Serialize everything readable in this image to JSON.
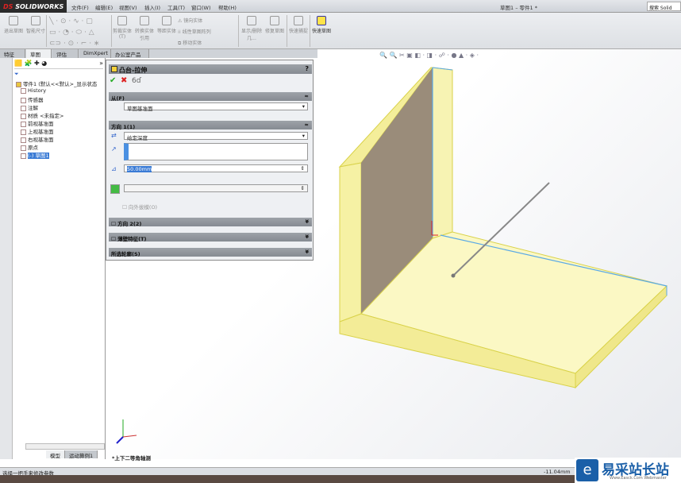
{
  "app": {
    "brand": "SOLIDWORKS",
    "title": "草图1 – 零件1 *",
    "search_placeholder": "搜索 Solid"
  },
  "menu": [
    "文件(F)",
    "编辑(E)",
    "视图(V)",
    "插入(I)",
    "工具(T)",
    "窗口(W)",
    "帮助(H)"
  ],
  "toolbar": {
    "exit_sketch": "退出草图",
    "smart_dim": "智能尺寸",
    "trim": "剪裁实体(T)",
    "convert": "转换实体引用",
    "offset": "等距实体",
    "mirror": "镜向实体",
    "linear_pattern": "线性草图阵列",
    "move": "移动实体",
    "display_delete": "显示/删除几...",
    "repair": "修复草图",
    "quick_snap": "快速捕捉",
    "rapid_sketch": "快速草图"
  },
  "tabs": [
    "特征",
    "草图",
    "评估",
    "DimXpert",
    "办公室产品"
  ],
  "active_tab": "草图",
  "tree": {
    "root": "零件1 (默认<<默认>_显示状态",
    "items": [
      "History",
      "传感器",
      "注解",
      "材质 <未指定>",
      "前视基准面",
      "上视基准面",
      "右视基准面",
      "原点",
      "(-) 草图1"
    ]
  },
  "pm": {
    "title": "凸台-拉伸",
    "help": "?",
    "from_label": "从(F)",
    "from_value": "草图基准面",
    "dir1_label": "方向 1(1)",
    "end_condition": "给定深度",
    "depth": "50.00mm",
    "draft_outward": "向外拔模(O)",
    "dir2_label": "方向 2(2)",
    "thin_label": "薄壁特征(T)",
    "contours_label": "所选轮廓(S)"
  },
  "viewport": {
    "view_name": "*上下二等角轴测"
  },
  "bottom_tabs": [
    "模型",
    "运动算例1"
  ],
  "status": {
    "message": "选择一把手来修改参数",
    "coord": "-11.04mm"
  },
  "watermark": {
    "text": "易采站长站",
    "sub": "Www.Easck.Com Webmaster"
  },
  "colors": {
    "model_face": "#f7f2a8",
    "model_edge": "#d9d24a",
    "sketch": "#5aa9e6"
  }
}
